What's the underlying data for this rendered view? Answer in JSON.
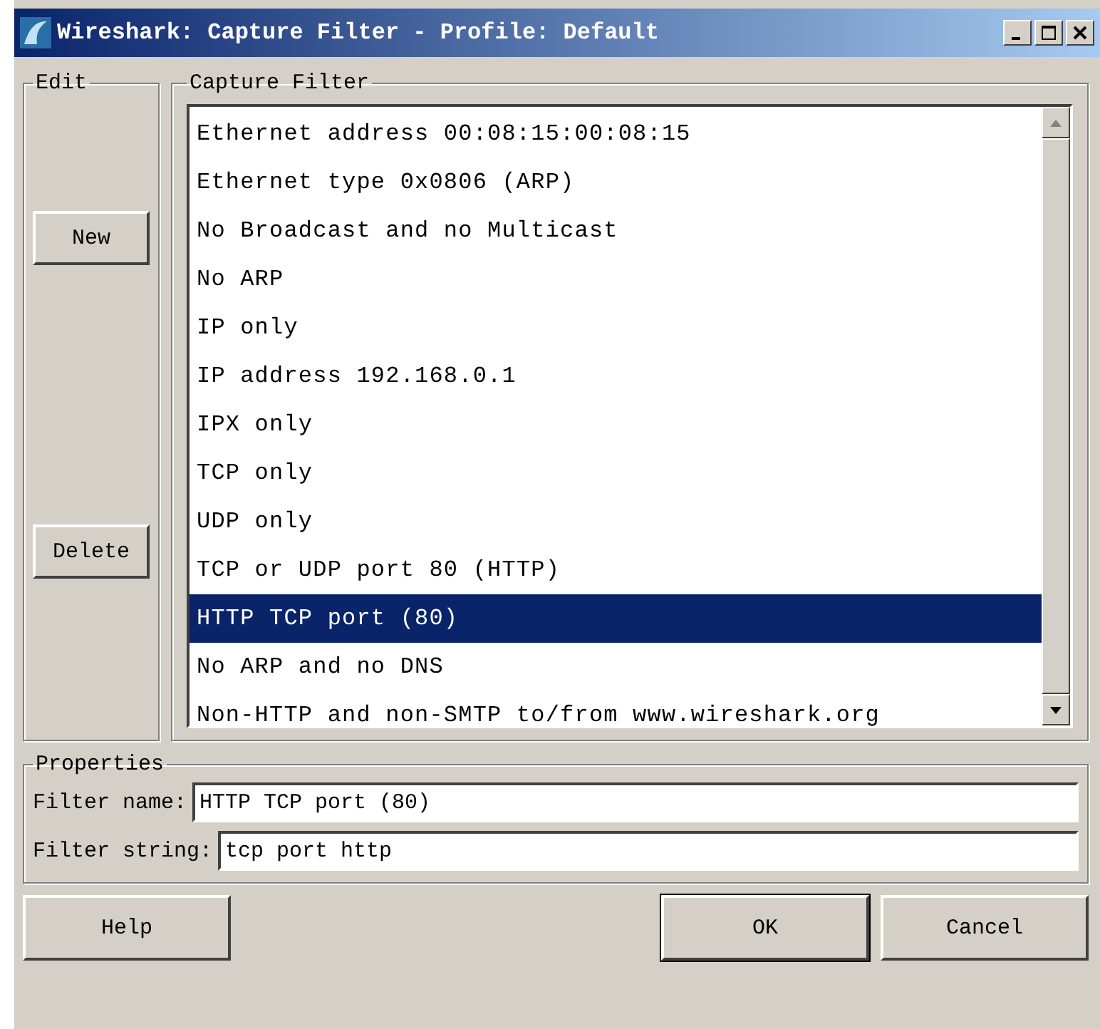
{
  "window": {
    "title": "Wireshark: Capture Filter - Profile: Default"
  },
  "edit": {
    "title": "Edit",
    "buttons": [
      "New",
      "Delete"
    ]
  },
  "capture_filter": {
    "title": "Capture Filter",
    "items": [
      {
        "label": "Ethernet address 00:08:15:00:08:15",
        "selected": false
      },
      {
        "label": "Ethernet type 0x0806 (ARP)",
        "selected": false
      },
      {
        "label": "No Broadcast and no Multicast",
        "selected": false
      },
      {
        "label": "No ARP",
        "selected": false
      },
      {
        "label": "IP only",
        "selected": false
      },
      {
        "label": "IP address 192.168.0.1",
        "selected": false
      },
      {
        "label": "IPX only",
        "selected": false
      },
      {
        "label": "TCP only",
        "selected": false
      },
      {
        "label": "UDP only",
        "selected": false
      },
      {
        "label": "TCP or UDP port 80 (HTTP)",
        "selected": false
      },
      {
        "label": "HTTP TCP port (80)",
        "selected": true
      },
      {
        "label": "No ARP and no DNS",
        "selected": false
      },
      {
        "label": "Non-HTTP and non-SMTP to/from www.wireshark.org",
        "selected": false
      }
    ]
  },
  "properties": {
    "title": "Properties",
    "fields": [
      {
        "label": "Filter name:",
        "value": "HTTP TCP port (80)"
      },
      {
        "label": "Filter string:",
        "value": "tcp port http"
      }
    ]
  },
  "buttons": {
    "left": [
      "Help"
    ],
    "right": [
      "OK",
      "Cancel"
    ]
  }
}
